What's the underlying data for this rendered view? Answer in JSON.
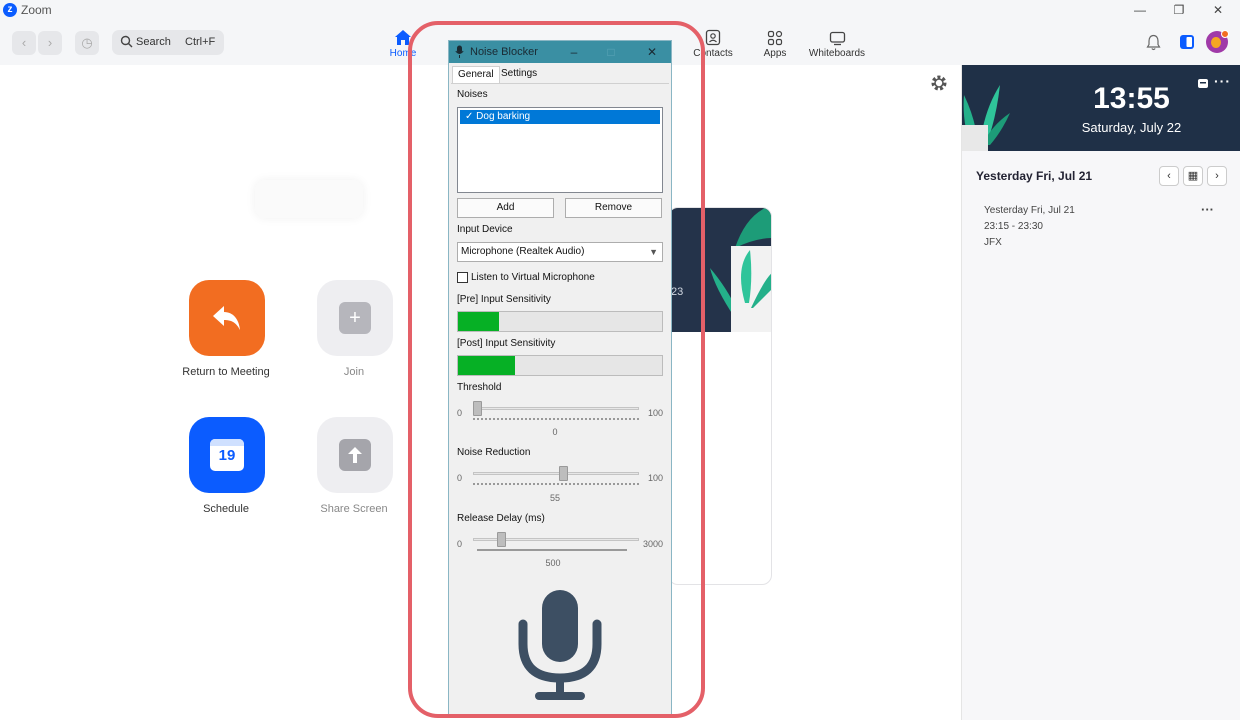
{
  "window": {
    "title": "Zoom"
  },
  "toolbar": {
    "search_label": "Search",
    "search_shortcut": "Ctrl+F",
    "tabs": [
      {
        "label": "Home",
        "icon": "home-icon",
        "active": true
      },
      {
        "label": "Contacts",
        "icon": "contacts-icon"
      },
      {
        "label": "Apps",
        "icon": "apps-icon"
      },
      {
        "label": "Whiteboards",
        "icon": "whiteboard-icon"
      }
    ]
  },
  "home": {
    "return_label": "Return to Meeting",
    "join_label": "Join",
    "schedule_label": "Schedule",
    "schedule_day": "19",
    "share_label": "Share Screen",
    "card_partial_text": "23"
  },
  "calendar": {
    "time": "13:55",
    "date": "Saturday, July 22",
    "day_title": "Yesterday Fri, Jul 21",
    "meeting": {
      "date": "Yesterday Fri, Jul 21",
      "time_range": "23:15 - 23:30",
      "title": "JFX"
    }
  },
  "noise_blocker": {
    "title": "Noise Blocker",
    "tabs": [
      "General",
      "Settings"
    ],
    "noises_label": "Noises",
    "noises": [
      "Dog barking"
    ],
    "add_label": "Add",
    "remove_label": "Remove",
    "input_device_label": "Input Device",
    "input_device_value": "Microphone (Realtek Audio)",
    "listen_label": "Listen to Virtual Microphone",
    "listen_checked": false,
    "pre_label": "[Pre] Input Sensitivity",
    "pre_level": 0.2,
    "post_label": "[Post] Input Sensitivity",
    "post_level": 0.28,
    "threshold": {
      "label": "Threshold",
      "min": "0",
      "max": "100",
      "value": "0"
    },
    "noise_reduction": {
      "label": "Noise Reduction",
      "min": "0",
      "max": "100",
      "value": "55"
    },
    "release_delay": {
      "label": "Release Delay (ms)",
      "min": "0",
      "max": "3000",
      "value": "500"
    }
  },
  "colors": {
    "accent": "#0b5cff",
    "return_orange": "#f26d21",
    "meter_green": "#06b025",
    "highlight_red": "#e46068",
    "nb_titlebar": "#3a8fa3",
    "mic_icon": "#3d4f63"
  }
}
